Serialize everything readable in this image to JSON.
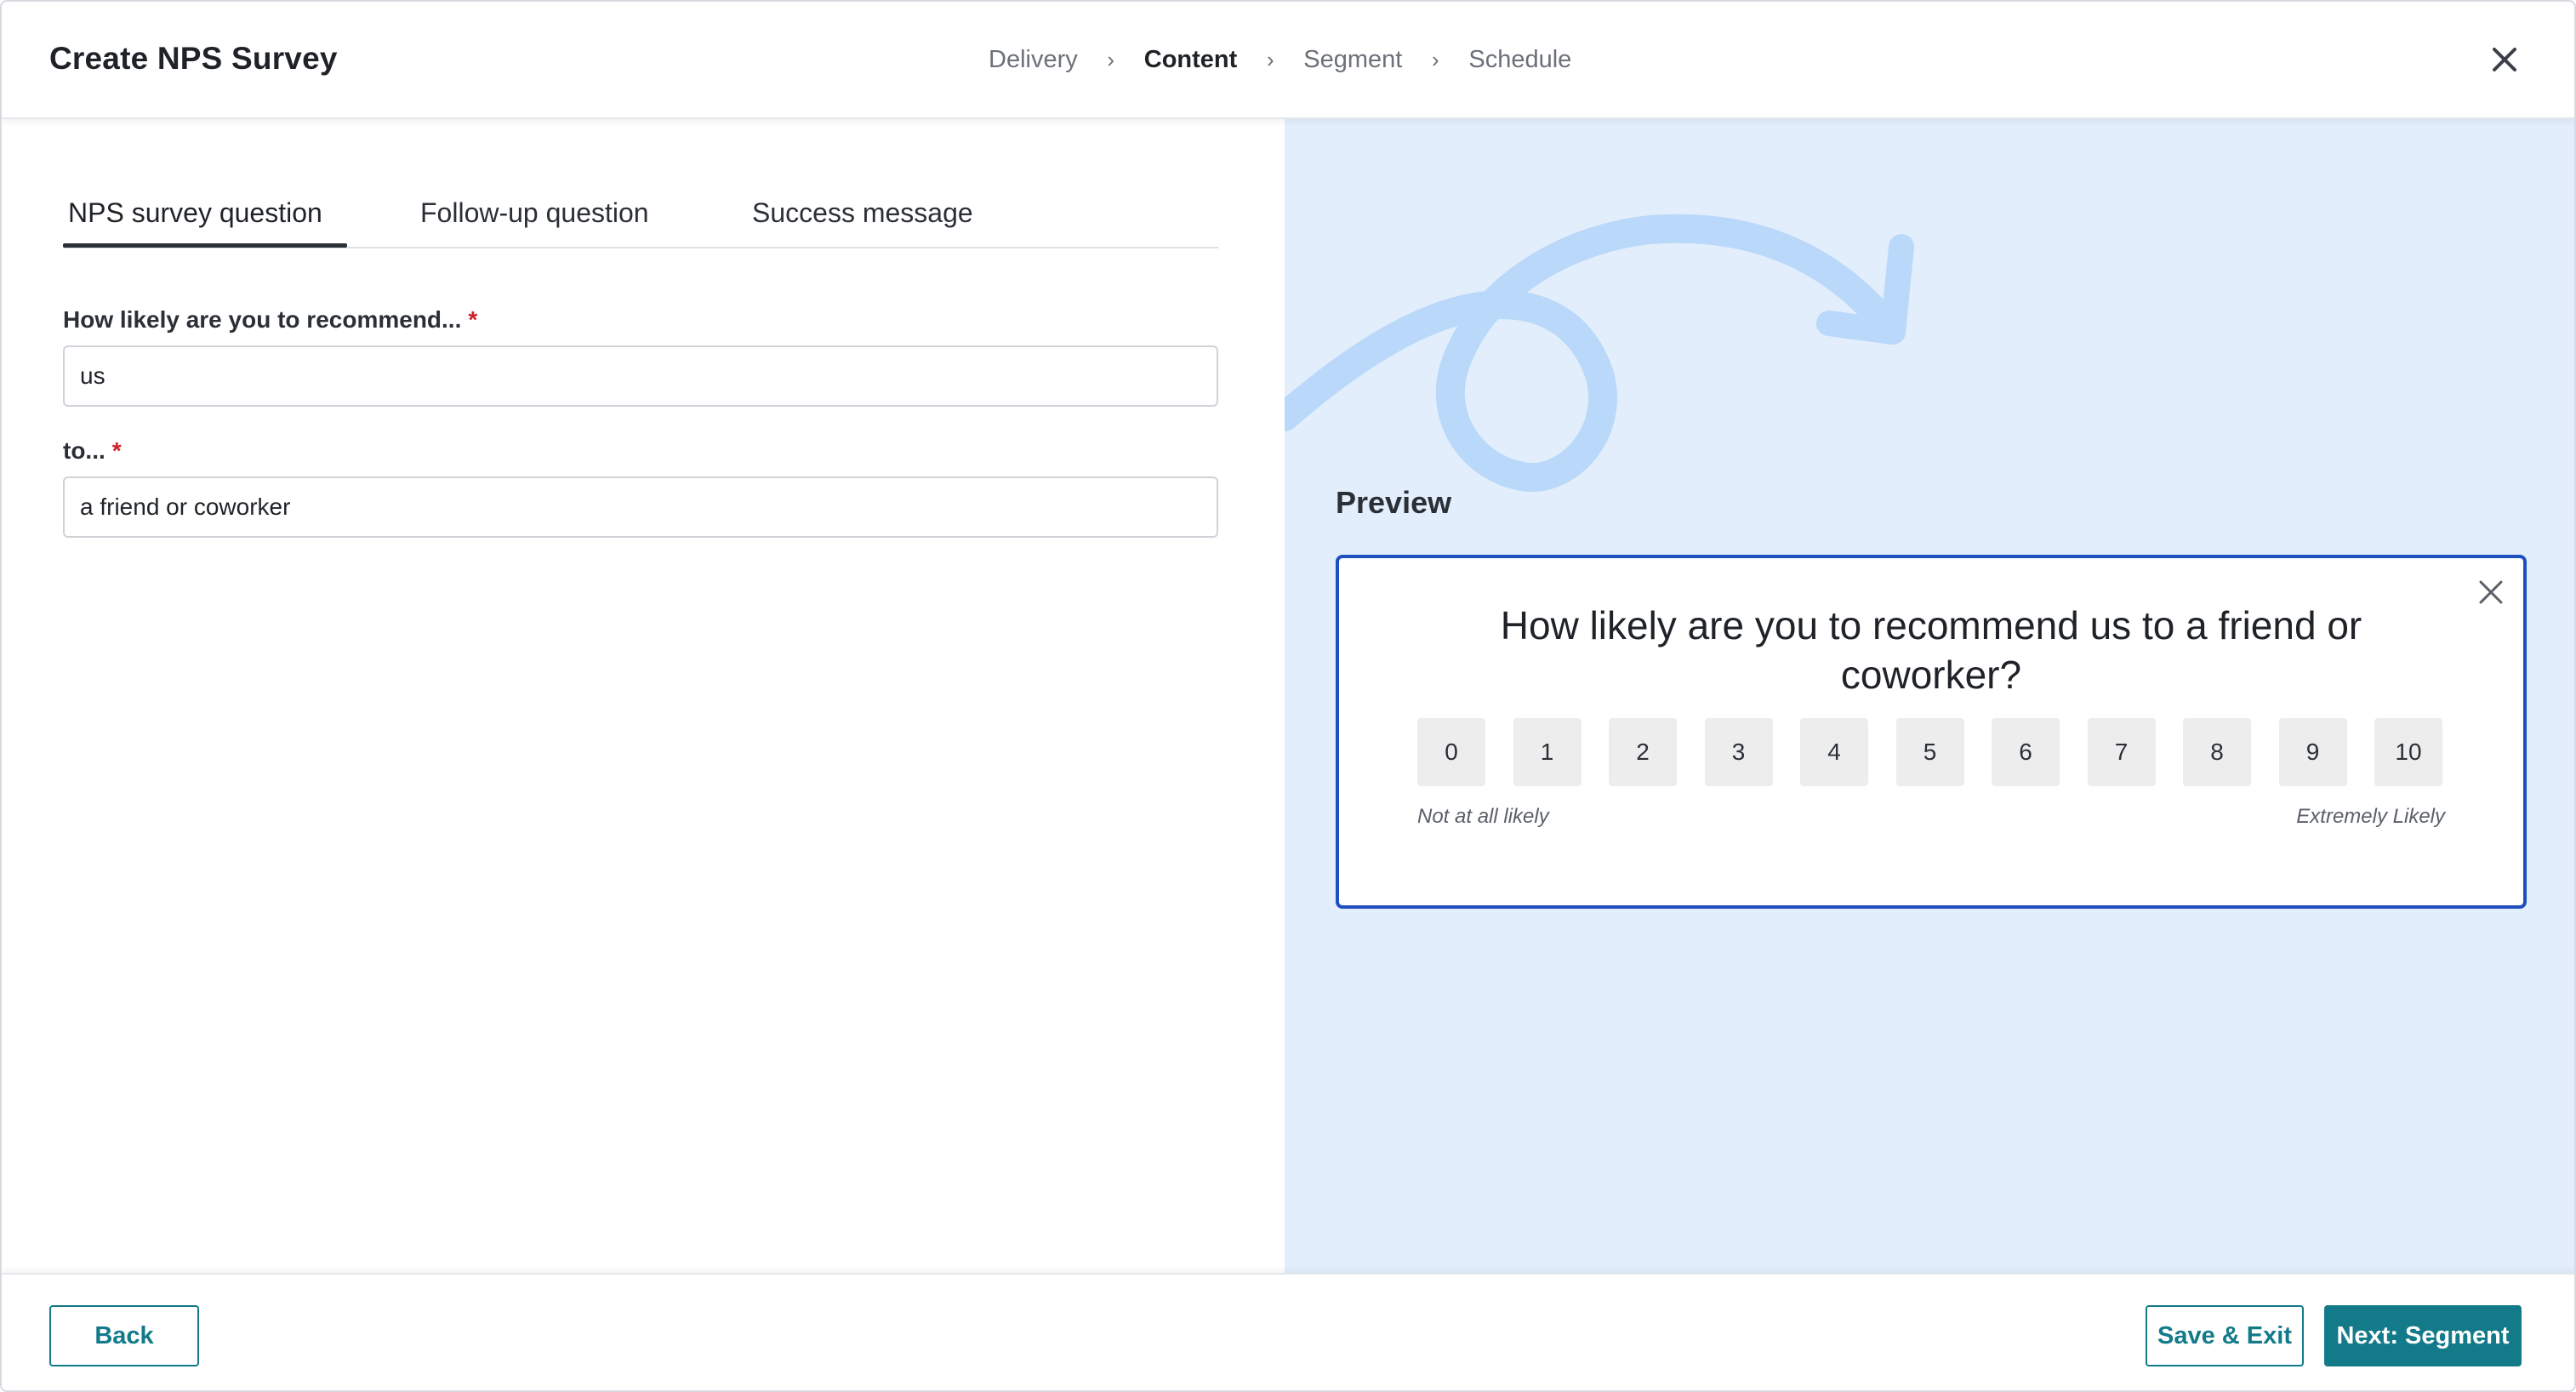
{
  "header": {
    "title": "Create NPS Survey",
    "steps": [
      {
        "label": "Delivery",
        "active": false
      },
      {
        "label": "Content",
        "active": true
      },
      {
        "label": "Segment",
        "active": false
      },
      {
        "label": "Schedule",
        "active": false
      }
    ]
  },
  "tabs": [
    {
      "label": "NPS survey question",
      "active": true
    },
    {
      "label": "Follow-up question",
      "active": false
    },
    {
      "label": "Success message",
      "active": false
    }
  ],
  "form": {
    "recommend_label": "How likely are you to recommend...",
    "recommend_value": "us",
    "to_label": "to...",
    "to_value": "a friend or coworker",
    "required_mark": "*"
  },
  "preview": {
    "label": "Preview",
    "question": "How likely are you to recommend us to a friend or coworker?",
    "scale": [
      "0",
      "1",
      "2",
      "3",
      "4",
      "5",
      "6",
      "7",
      "8",
      "9",
      "10"
    ],
    "low_label": "Not at all likely",
    "high_label": "Extremely Likely"
  },
  "footer": {
    "back_label": "Back",
    "save_label": "Save & Exit",
    "next_label": "Next: Segment"
  },
  "colors": {
    "accent": "#137a8a",
    "preview_bg": "#e2eefb",
    "card_border": "#1f4fbf",
    "required": "#d0202a"
  },
  "icons": {
    "close": "close-icon",
    "chevron": "chevron-right-icon"
  }
}
